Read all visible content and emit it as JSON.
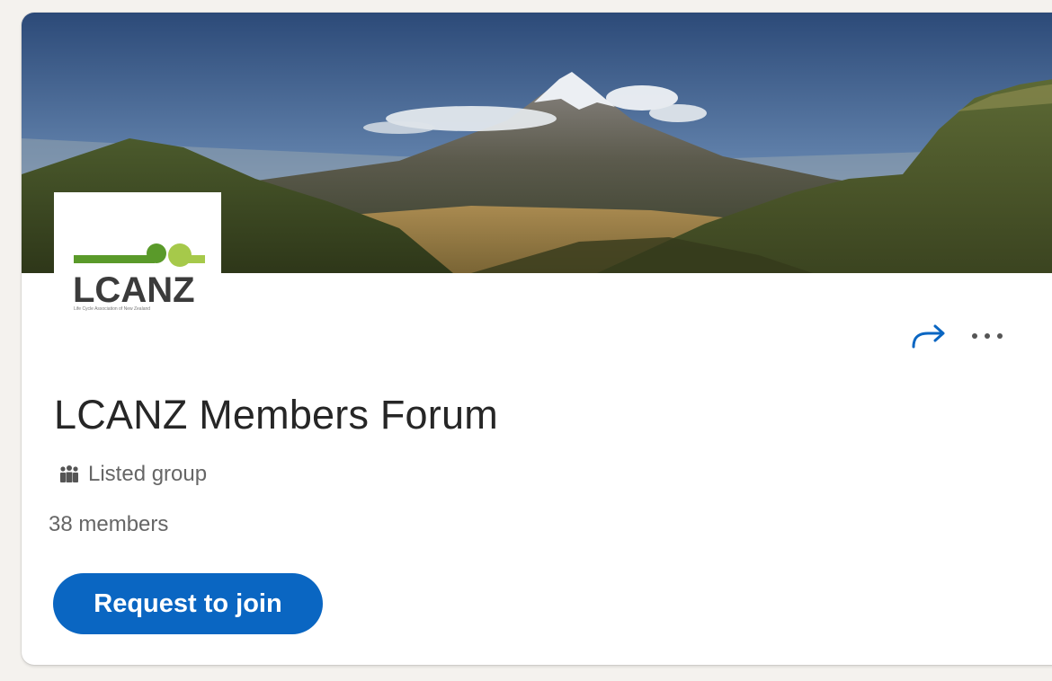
{
  "group": {
    "logo_text": "LCANZ",
    "logo_tagline": "Life Cycle Association of New Zealand",
    "title": "LCANZ Members Forum",
    "privacy_label": "Listed group",
    "members_label": "38 members",
    "join_label": "Request to join"
  },
  "icons": {
    "share": "share-arrow-icon",
    "more": "more-horizontal-icon",
    "privacy": "group-people-icon"
  },
  "colors": {
    "primary": "#0a66c2",
    "title_text": "#262626",
    "meta_text": "#666666",
    "logo_green_dark": "#5a9a2a",
    "logo_green_light": "#a6c94a",
    "logo_text": "#3b3b3b"
  }
}
